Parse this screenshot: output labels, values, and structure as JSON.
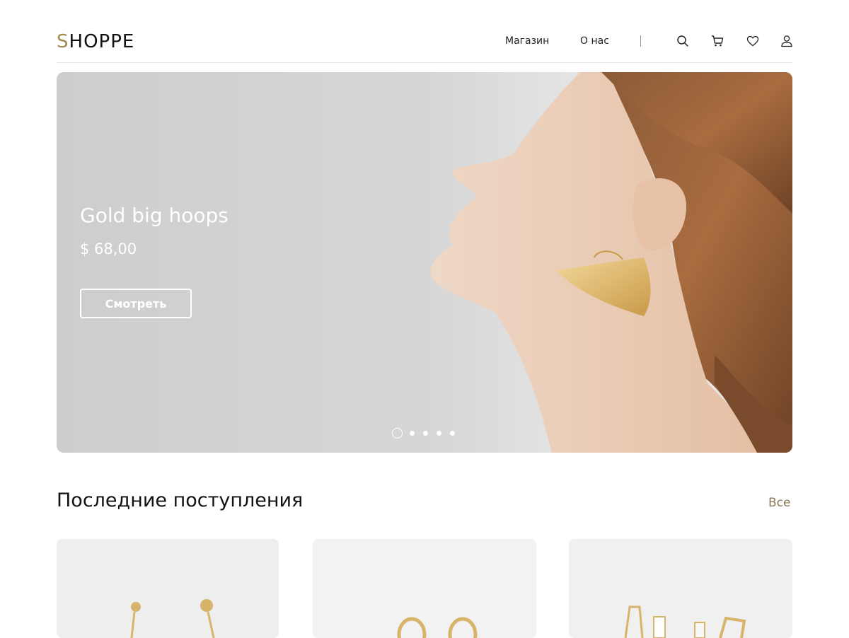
{
  "header": {
    "logo_first_letter": "S",
    "logo_rest": "HOPPE",
    "nav": {
      "shop": "Магазин",
      "about": "О нас"
    },
    "icons": [
      "search-icon",
      "cart-icon",
      "heart-icon",
      "user-icon"
    ]
  },
  "hero": {
    "title": "Gold big hoops",
    "price": "$ 68,00",
    "button_label": "Смотреть",
    "slides_total": 5,
    "active_slide": 1
  },
  "section": {
    "title": "Последние поступления",
    "see_all": "Все"
  },
  "colors": {
    "accent": "#a18a4e",
    "see_all": "#8a7a55",
    "gold": "#d8b46a"
  }
}
